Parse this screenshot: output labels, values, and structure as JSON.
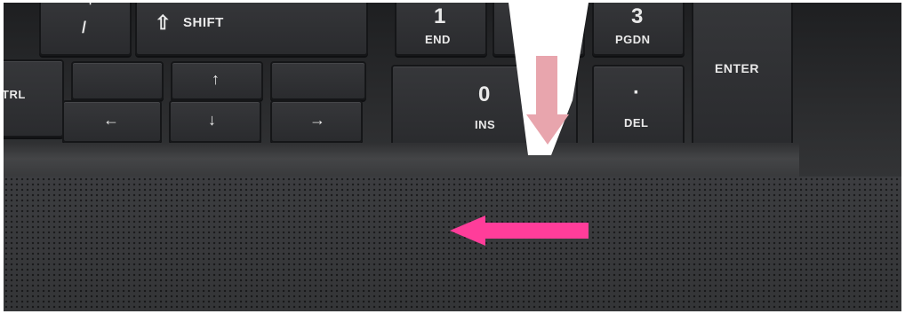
{
  "keys": {
    "shift": "SHIFT",
    "shift_symbol": "⇧",
    "backslash": "/",
    "backslash_top": "'",
    "ctrl": "TRL",
    "up": "↑",
    "down": "↓",
    "left": "←",
    "right": "→",
    "one_num": "1",
    "one_label": "END",
    "three_num": "3",
    "three_label": "PGDN",
    "zero_num": "0",
    "zero_label": "INS",
    "dot_num": "·",
    "dot_label": "DEL",
    "enter": "ENTER"
  },
  "colors": {
    "pink_arrow": "#ff3d9a",
    "faded_pink_arrow": "#e8a5ad",
    "white_overlay": "#ffffff"
  }
}
